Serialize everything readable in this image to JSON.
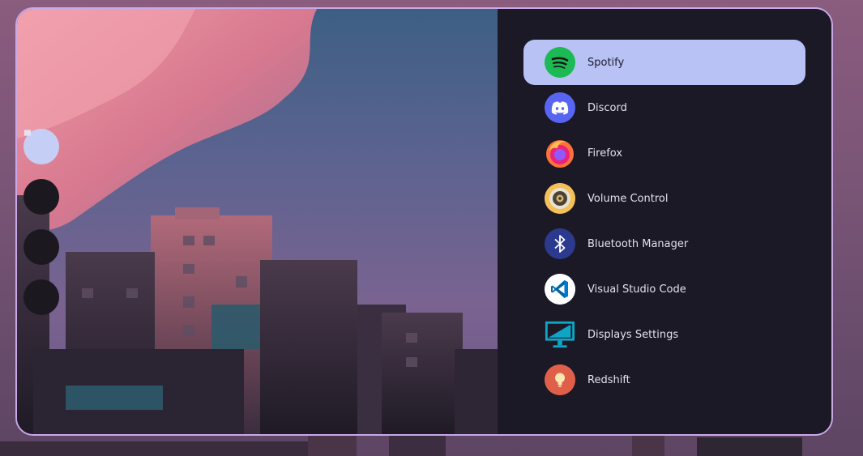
{
  "launcher": {
    "accent_border": "#c9a8e8",
    "selected_bg": "#b9c2f5",
    "panel_bg": "#1b1925"
  },
  "side_buttons": [
    {
      "name": "chevron-up-icon",
      "glyph": "chevron-up",
      "active": true
    },
    {
      "name": "folder-icon",
      "glyph": "folder",
      "active": false
    },
    {
      "name": "window-icon",
      "glyph": "window",
      "active": false
    },
    {
      "name": "terminal-icon",
      "glyph": "terminal",
      "active": false
    }
  ],
  "apps": [
    {
      "label": "Spotify",
      "icon": "spotify-icon",
      "selected": true
    },
    {
      "label": "Discord",
      "icon": "discord-icon",
      "selected": false
    },
    {
      "label": "Firefox",
      "icon": "firefox-icon",
      "selected": false
    },
    {
      "label": "Volume Control",
      "icon": "volume-control-icon",
      "selected": false
    },
    {
      "label": "Bluetooth Manager",
      "icon": "bluetooth-icon",
      "selected": false
    },
    {
      "label": "Visual Studio Code",
      "icon": "vscode-icon",
      "selected": false
    },
    {
      "label": "Displays Settings",
      "icon": "display-settings-icon",
      "selected": false
    },
    {
      "label": "Redshift",
      "icon": "redshift-icon",
      "selected": false
    }
  ]
}
